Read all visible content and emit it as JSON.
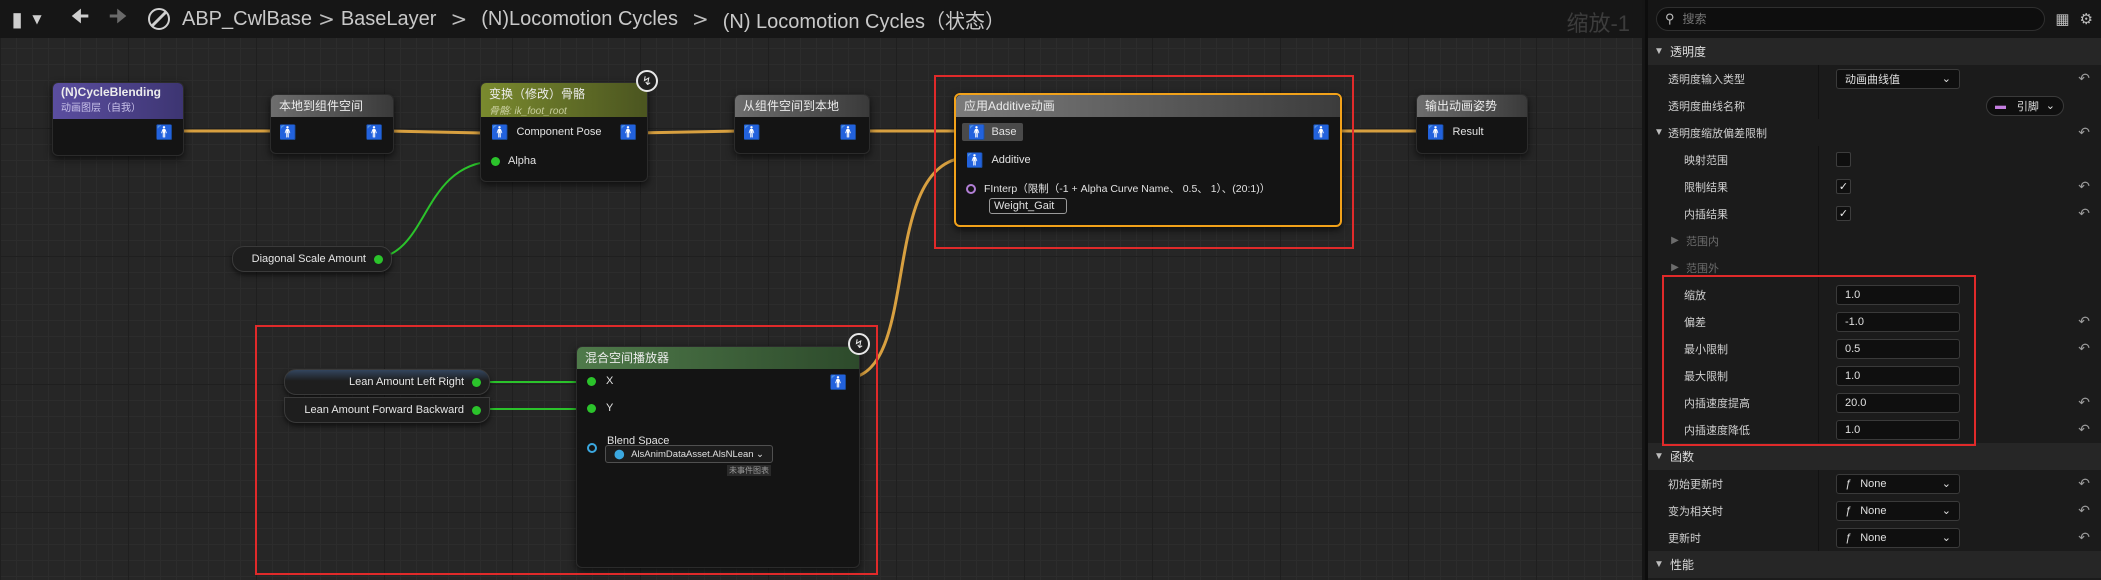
{
  "breadcrumb": {
    "items": [
      "ABP_CwlBase",
      "BaseLayer",
      "(N)Locomotion Cycles",
      "(N) Locomotion Cycles（状态）"
    ],
    "separator": ">"
  },
  "zoom_label": "缩放-1",
  "nodes": {
    "cycle_blending": {
      "title": "(N)CycleBlending",
      "subtitle": "动画图层（自我）"
    },
    "local_to_component": {
      "title": "本地到组件空间"
    },
    "transform_bone": {
      "title": "变换（修改）骨骼",
      "subtitle": "骨骼: ik_foot_root",
      "pin_pose": "Component Pose",
      "pin_alpha": "Alpha"
    },
    "component_to_local": {
      "title": "从组件空间到本地"
    },
    "apply_additive": {
      "title": "应用Additive动画",
      "pin_base": "Base",
      "pin_additive": "Additive",
      "alpha_expr": "FInterp（限制（-1 + Alpha Curve Name、 0.5、 1）、(20:1)）",
      "alpha_value": "Weight_Gait"
    },
    "output_pose": {
      "title": "输出动画姿势",
      "pin_result": "Result"
    },
    "diagonal_scale": {
      "label": "Diagonal Scale Amount"
    },
    "lean_lr": {
      "label": "Lean Amount Left Right"
    },
    "lean_fb": {
      "label": "Lean Amount Forward Backward"
    },
    "blendspace_player": {
      "title": "混合空间播放器",
      "pin_x": "X",
      "pin_y": "Y",
      "blend_space_label": "Blend Space",
      "blend_space_value": "AlsAnimDataAsset.AlsNLean",
      "hint": "未事件图表"
    }
  },
  "panel": {
    "search_placeholder": "搜索",
    "sections": {
      "opacity": "透明度",
      "functions": "函数",
      "performance": "性能"
    },
    "rows": {
      "input_type_label": "透明度输入类型",
      "input_type_value": "动画曲线值",
      "curve_name_label": "透明度曲线名称",
      "curve_name_value": "引脚",
      "scale_bias_label": "透明度缩放偏差限制",
      "map_range_label": "映射范围",
      "clamp_result_label": "限制结果",
      "interp_result_label": "内插结果",
      "range_in_label": "范围内",
      "range_out_label": "范围外",
      "scale_label": "缩放",
      "scale_value": "1.0",
      "bias_label": "偏差",
      "bias_value": "-1.0",
      "clamp_min_label": "最小限制",
      "clamp_min_value": "0.5",
      "clamp_max_label": "最大限制",
      "clamp_max_value": "1.0",
      "interp_up_label": "内插速度提高",
      "interp_up_value": "20.0",
      "interp_down_label": "内插速度降低",
      "interp_down_value": "1.0",
      "on_init_label": "初始更新时",
      "on_init_value": "None",
      "on_relevant_label": "变为相关时",
      "on_relevant_value": "None",
      "on_update_label": "更新时",
      "on_update_value": "None"
    },
    "checks": {
      "map_range": false,
      "clamp_result": true,
      "interp_result": true
    }
  },
  "colors": {
    "exec_wire": "#d8a040",
    "float_wire": "#2bc32b",
    "highlight": "#e02a2a",
    "selected_border": "#f2a21a"
  }
}
